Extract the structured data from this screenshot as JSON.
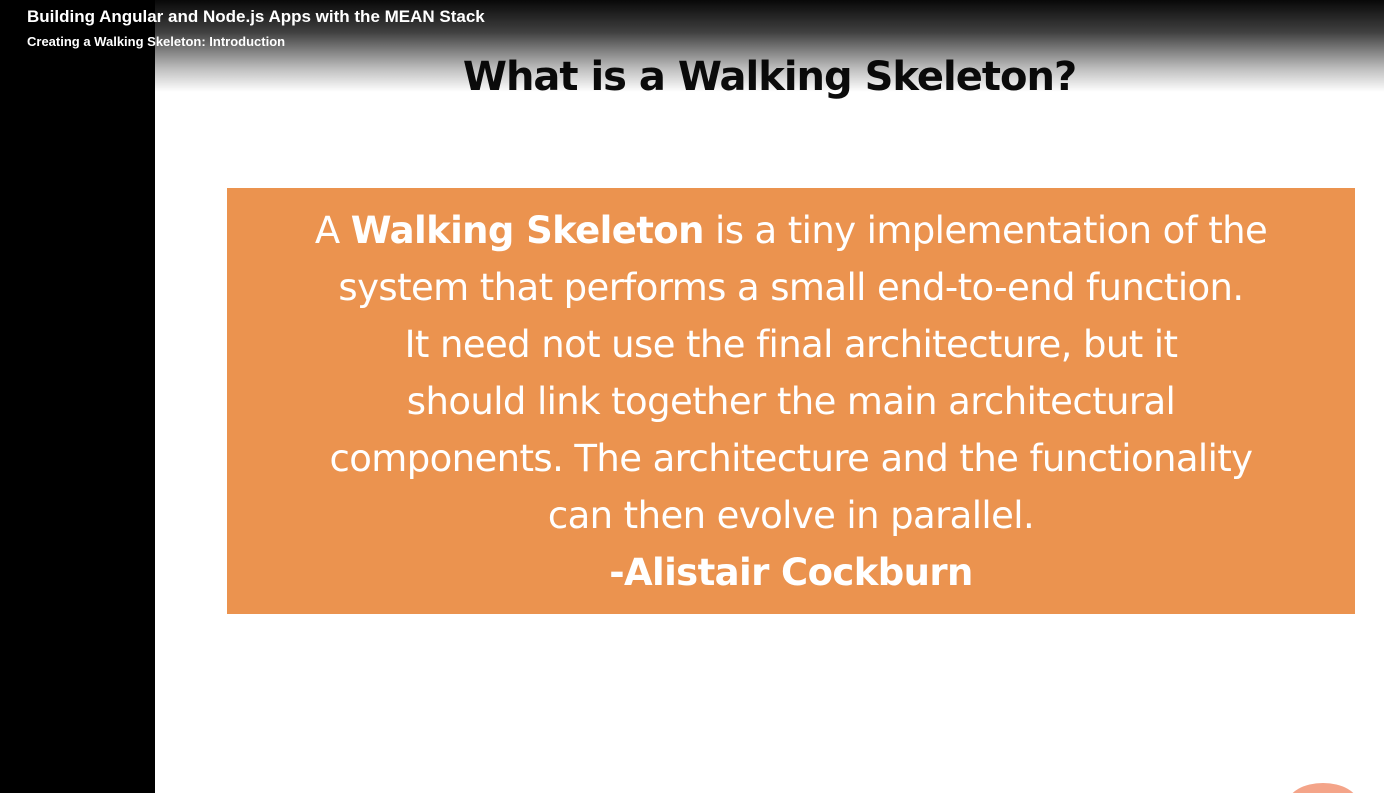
{
  "header": {
    "course_title": "Building Angular and Node.js Apps with the MEAN Stack",
    "module_title": "Creating a Walking Skeleton: Introduction"
  },
  "slide": {
    "title": "What is a Walking Skeleton?",
    "quote": {
      "line1_prefix": "A ",
      "line1_bold": "Walking Skeleton",
      "line1_suffix": " is a tiny implementation of the",
      "line2": "system that performs a small end-to-end function.",
      "line3": "It need not use the final architecture, but it",
      "line4": "should link together the main architectural",
      "line5": "components. The architecture and the functionality",
      "line6": "can then evolve in parallel.",
      "author": "-Alistair Cockburn"
    }
  },
  "colors": {
    "quote_background": "#eb934f",
    "quote_text": "#ffffff",
    "slide_background": "#ffffff",
    "title_text": "#0c0c0c"
  }
}
